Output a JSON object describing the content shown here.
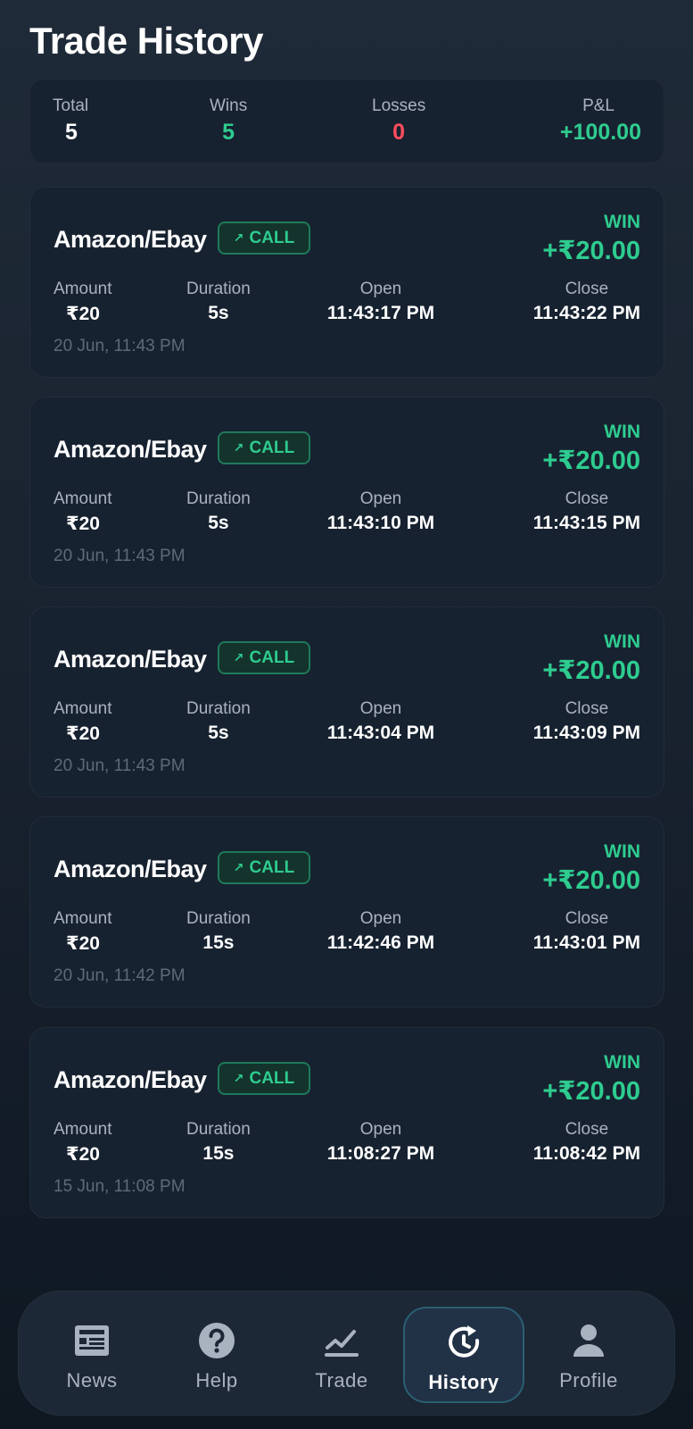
{
  "header": {
    "title": "Trade History"
  },
  "summary": {
    "total_label": "Total",
    "total": "5",
    "wins_label": "Wins",
    "wins": "5",
    "losses_label": "Losses",
    "losses": "0",
    "pnl_label": "P&L",
    "pnl": "+100.00"
  },
  "labels": {
    "amount": "Amount",
    "duration": "Duration",
    "open": "Open",
    "close": "Close"
  },
  "trades": [
    {
      "pair": "Amazon/Ebay",
      "direction": "CALL",
      "result": "WIN",
      "pnl": "+₹20.00",
      "amount": "₹20",
      "duration": "5s",
      "open": "11:43:17 PM",
      "close": "11:43:22 PM",
      "timestamp": "20 Jun, 11:43 PM"
    },
    {
      "pair": "Amazon/Ebay",
      "direction": "CALL",
      "result": "WIN",
      "pnl": "+₹20.00",
      "amount": "₹20",
      "duration": "5s",
      "open": "11:43:10 PM",
      "close": "11:43:15 PM",
      "timestamp": "20 Jun, 11:43 PM"
    },
    {
      "pair": "Amazon/Ebay",
      "direction": "CALL",
      "result": "WIN",
      "pnl": "+₹20.00",
      "amount": "₹20",
      "duration": "5s",
      "open": "11:43:04 PM",
      "close": "11:43:09 PM",
      "timestamp": "20 Jun, 11:43 PM"
    },
    {
      "pair": "Amazon/Ebay",
      "direction": "CALL",
      "result": "WIN",
      "pnl": "+₹20.00",
      "amount": "₹20",
      "duration": "15s",
      "open": "11:42:46 PM",
      "close": "11:43:01 PM",
      "timestamp": "20 Jun, 11:42 PM"
    },
    {
      "pair": "Amazon/Ebay",
      "direction": "CALL",
      "result": "WIN",
      "pnl": "+₹20.00",
      "amount": "₹20",
      "duration": "15s",
      "open": "11:08:27 PM",
      "close": "11:08:42 PM",
      "timestamp": "15 Jun, 11:08 PM"
    }
  ],
  "nav": {
    "items": [
      {
        "label": "News",
        "icon": "newspaper-icon"
      },
      {
        "label": "Help",
        "icon": "help-icon"
      },
      {
        "label": "Trade",
        "icon": "chart-icon"
      },
      {
        "label": "History",
        "icon": "history-icon",
        "active": true
      },
      {
        "label": "Profile",
        "icon": "user-icon"
      }
    ]
  },
  "colors": {
    "win": "#2ecc8f",
    "loss": "#ff4d5e",
    "card": "#172230",
    "accent_border": "#2b5f73"
  }
}
